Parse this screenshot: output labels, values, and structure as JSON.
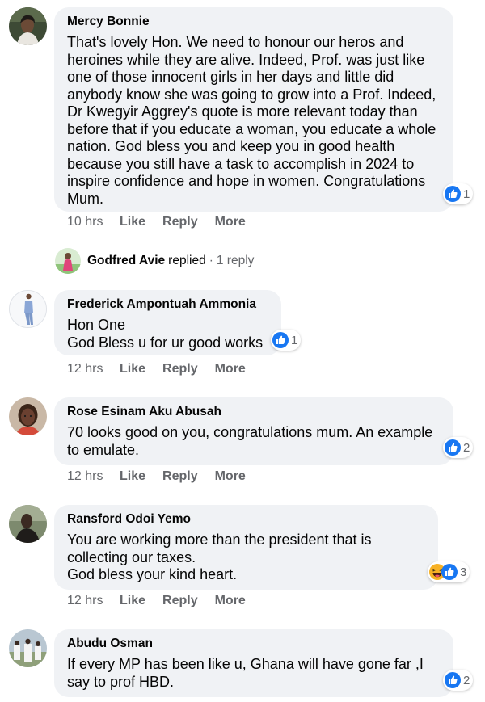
{
  "comments": [
    {
      "author": "Mercy Bonnie",
      "text": "That's lovely Hon. We need to honour our heros and heroines while they are alive. Indeed, Prof. was just like one of those innocent girls in her days and little did anybody know she was going to grow into a Prof. Indeed, Dr Kwegyir Aggrey's quote is more relevant today than before that if you educate a woman, you educate a whole nation. God bless you and keep you in good health because you still have a task to accomplish in 2024 to inspire confidence and hope in women. Congratulations Mum.",
      "reactions": [
        "like-icon"
      ],
      "reaction_count": "1",
      "time": "10 hrs",
      "actions": [
        "Like",
        "Reply",
        "More"
      ]
    },
    {
      "author": "Frederick Ampontuah Ammonia",
      "text": "Hon One\nGod Bless u for ur good works",
      "reactions": [
        "like-icon"
      ],
      "reaction_count": "1",
      "time": "12 hrs",
      "actions": [
        "Like",
        "Reply",
        "More"
      ]
    },
    {
      "author": "Rose Esinam Aku Abusah",
      "text": "70 looks good on you, congratulations mum. An example to emulate.",
      "reactions": [
        "like-icon"
      ],
      "reaction_count": "2",
      "time": "12 hrs",
      "actions": [
        "Like",
        "Reply",
        "More"
      ]
    },
    {
      "author": "Ransford Odoi Yemo",
      "text": "You are working more than the president that is collecting our taxes.\nGod bless your kind heart.",
      "reactions": [
        "haha-icon",
        "like-icon"
      ],
      "reaction_count": "3",
      "time": "12 hrs",
      "actions": [
        "Like",
        "Reply",
        "More"
      ]
    },
    {
      "author": "Abudu Osman",
      "text": "If every MP has been like u, Ghana will have gone far ,I say to prof HBD.",
      "reactions": [
        "like-icon"
      ],
      "reaction_count": "2"
    }
  ],
  "reply_summary": {
    "name": "Godfred Avie",
    "verb": "replied",
    "separator": "·",
    "count": "1 reply"
  },
  "colors": {
    "bubble": "#f0f2f5",
    "meta_text": "#65676b",
    "like_blue": "#1877f2",
    "haha_yellow": "#f7b125"
  }
}
